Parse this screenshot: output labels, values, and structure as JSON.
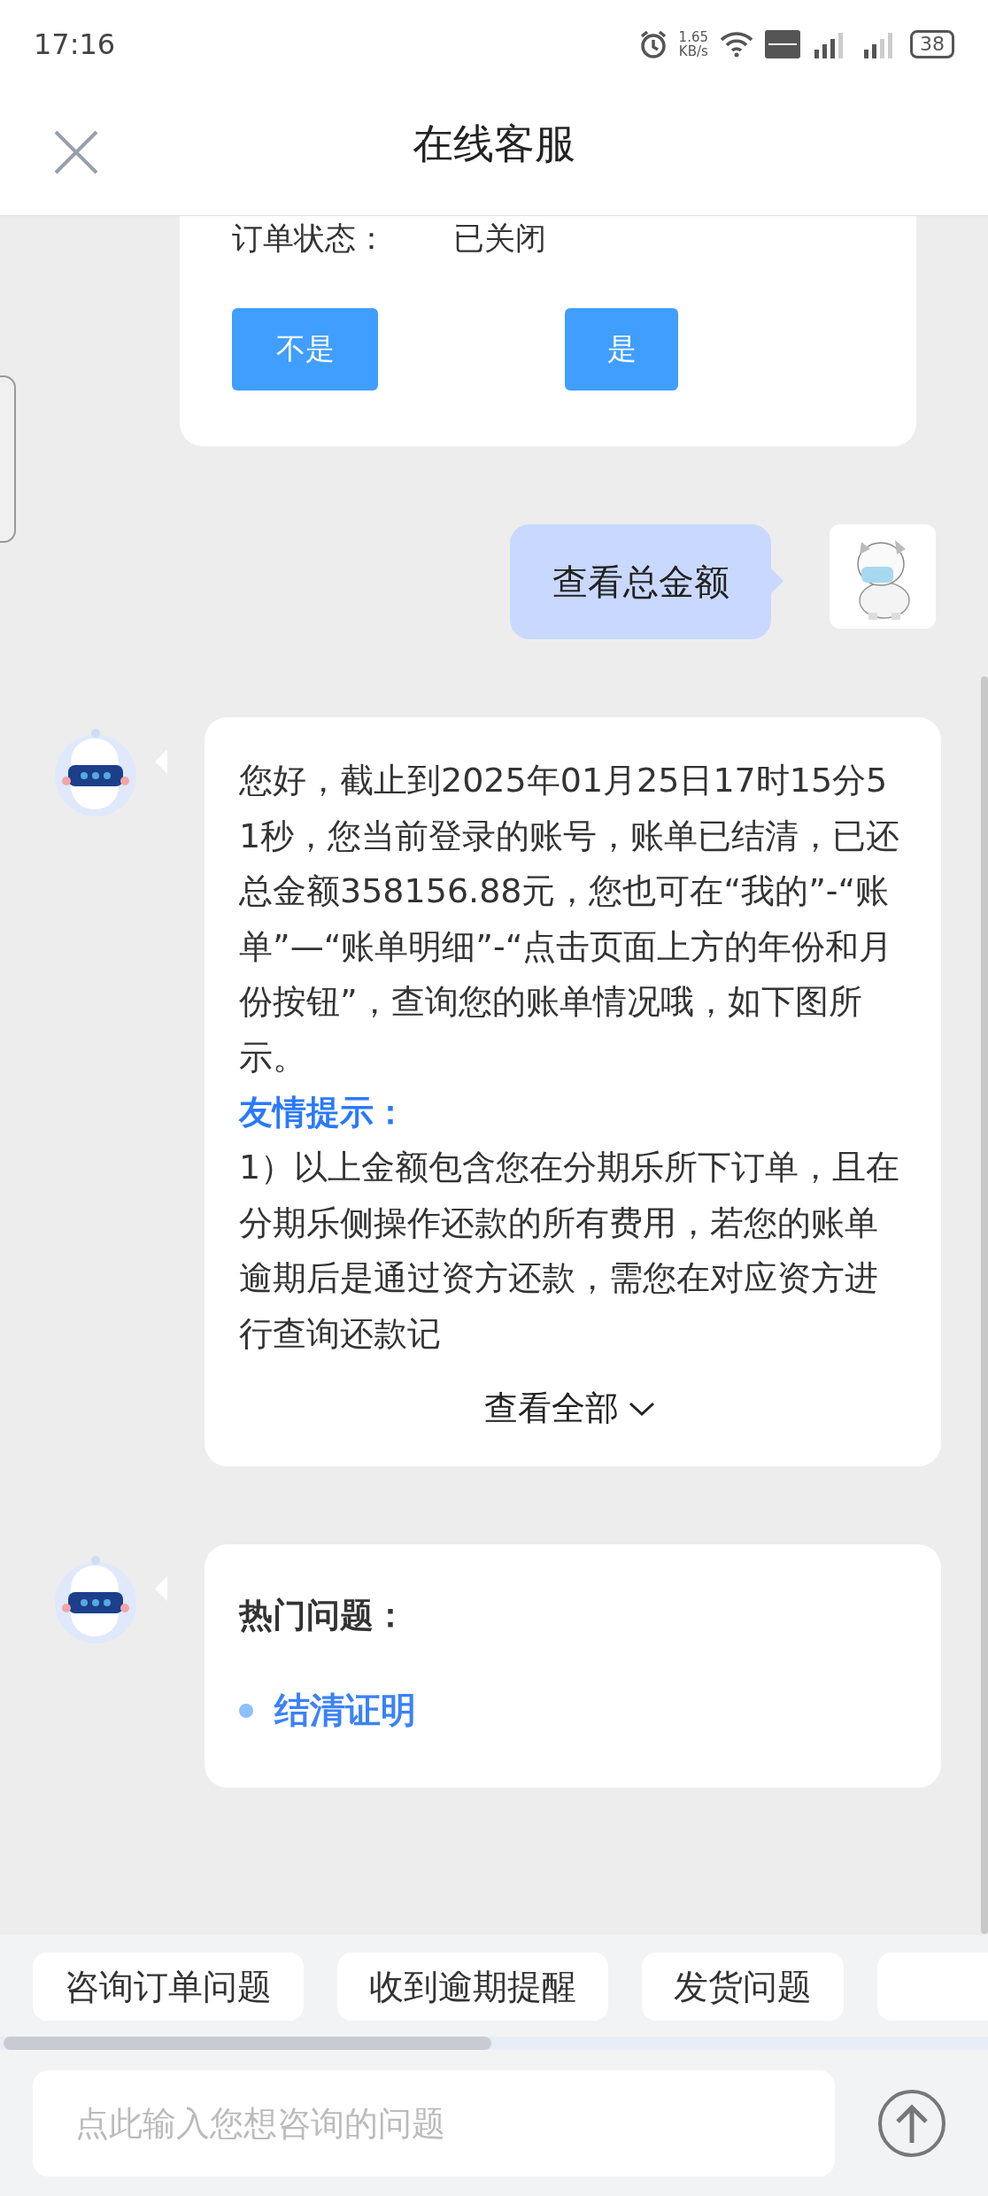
{
  "status_bar": {
    "time": "17:16",
    "net_speed_value": "1.65",
    "net_speed_unit": "KB/s",
    "battery": "38"
  },
  "header": {
    "title": "在线客服"
  },
  "order_card": {
    "label": "订单状态：",
    "value": "已关闭",
    "buttons": [
      "不是",
      "是"
    ]
  },
  "user_message": {
    "text": "查看总金额"
  },
  "bot_message": {
    "intro": "您好，截止到2025年01月25日17时15分51秒，您当前登录的账号，账单已结清，已还总金额358156.88元，您也可在“我的”-“账单”—“账单明细”-“点击页面上方的年份和月份按钮”，查询您的账单情况哦，如下图所示。",
    "tip_title": "友情提示：",
    "tip_text": "1）以上金额包含您在分期乐所下订单，且在分期乐侧操作还款的所有费用，若您的账单逾期后是通过资方还款，需您在对应资方进行查询还款记",
    "expand": "查看全部"
  },
  "hot_questions": {
    "title": "热门问题：",
    "items": [
      "结清证明"
    ]
  },
  "quick_questions": [
    "咨询订单问题",
    "收到逾期提醒",
    "发货问题"
  ],
  "input": {
    "placeholder": "点此输入您想咨询的问题"
  }
}
